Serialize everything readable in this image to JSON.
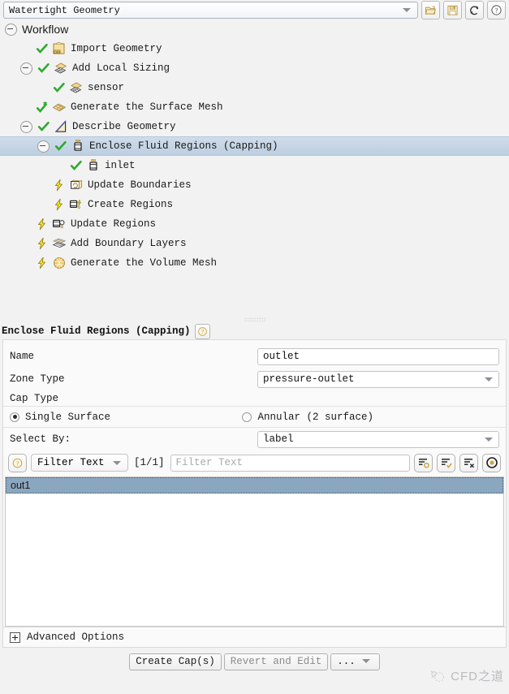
{
  "topbar": {
    "workflow_selector": "Watertight Geometry",
    "buttons": [
      {
        "name": "open-workflow-button",
        "icon": "open-folder-icon"
      },
      {
        "name": "save-workflow-button",
        "icon": "save-disk-icon"
      },
      {
        "name": "reset-workflow-button",
        "icon": "refresh-icon"
      },
      {
        "name": "help-button",
        "icon": "question-mark-icon"
      }
    ]
  },
  "tree": {
    "root_label": "Workflow",
    "items": [
      {
        "label": "Import Geometry",
        "state": "check",
        "icon": "cad-import-icon",
        "indent": 1,
        "expander": "none",
        "selected": false
      },
      {
        "label": "Add Local Sizing",
        "state": "check",
        "icon": "local-sizing-icon",
        "indent": 1,
        "expander": "minus",
        "selected": false
      },
      {
        "label": "sensor",
        "state": "check",
        "icon": "local-sizing-icon",
        "indent": 2,
        "expander": "none",
        "selected": false
      },
      {
        "label": "Generate the Surface Mesh",
        "state": "check-star",
        "icon": "surface-mesh-icon",
        "indent": 1,
        "expander": "none",
        "selected": false
      },
      {
        "label": "Describe Geometry",
        "state": "check",
        "icon": "describe-geometry-icon",
        "indent": 1,
        "expander": "minus",
        "selected": false
      },
      {
        "label": "Enclose Fluid Regions (Capping)",
        "state": "check",
        "icon": "capping-icon",
        "indent": 2,
        "expander": "minus",
        "selected": true
      },
      {
        "label": "inlet",
        "state": "check",
        "icon": "capping-icon",
        "indent": 3,
        "expander": "none",
        "selected": false
      },
      {
        "label": "Update Boundaries",
        "state": "bolt",
        "icon": "update-boundaries-icon",
        "indent": 2,
        "expander": "none",
        "selected": false
      },
      {
        "label": "Create Regions",
        "state": "bolt",
        "icon": "create-regions-icon",
        "indent": 2,
        "expander": "none",
        "selected": false
      },
      {
        "label": "Update Regions",
        "state": "bolt",
        "icon": "update-regions-icon",
        "indent": 1,
        "expander": "none",
        "selected": false
      },
      {
        "label": "Add Boundary Layers",
        "state": "bolt",
        "icon": "boundary-layers-icon",
        "indent": 1,
        "expander": "none",
        "selected": false
      },
      {
        "label": "Generate the Volume Mesh",
        "state": "bolt",
        "icon": "volume-mesh-icon",
        "indent": 1,
        "expander": "none",
        "selected": false
      }
    ]
  },
  "panel": {
    "title": "Enclose Fluid Regions (Capping)",
    "name_label": "Name",
    "name_value": "outlet",
    "zone_type_label": "Zone Type",
    "zone_type_value": "pressure-outlet",
    "cap_type_label": "Cap Type",
    "cap_single_label": "Single Surface",
    "cap_annular_label": "Annular (2 surface)",
    "cap_selected": "Single Surface",
    "select_by_label": "Select By:",
    "select_by_value": "label",
    "filter_mode": "Filter Text",
    "page_count": "[1/1]",
    "filter_placeholder": "Filter Text",
    "filter_value": "",
    "list_items": [
      "out1"
    ],
    "list_selected": "out1",
    "list_tools": [
      {
        "name": "list-show-all-button",
        "icon": "list-circle-icon"
      },
      {
        "name": "list-select-all-button",
        "icon": "list-check-icon"
      },
      {
        "name": "list-deselect-all-button",
        "icon": "list-x-icon"
      },
      {
        "name": "list-highlight-button",
        "icon": "bullseye-icon"
      }
    ],
    "advanced_options_label": "Advanced Options",
    "buttons": {
      "create": "Create Cap(s)",
      "revert": "Revert and Edit",
      "more": "..."
    }
  },
  "watermark": {
    "text": "CFD之道"
  },
  "colors": {
    "selection_row": "#c4d4e3",
    "list_selection": "#8ba7bf",
    "check_green": "#2faa2f",
    "bolt_yellow": "#f5dd2a",
    "accent_gold": "#cfa94a",
    "background": "#f2f2f2"
  }
}
